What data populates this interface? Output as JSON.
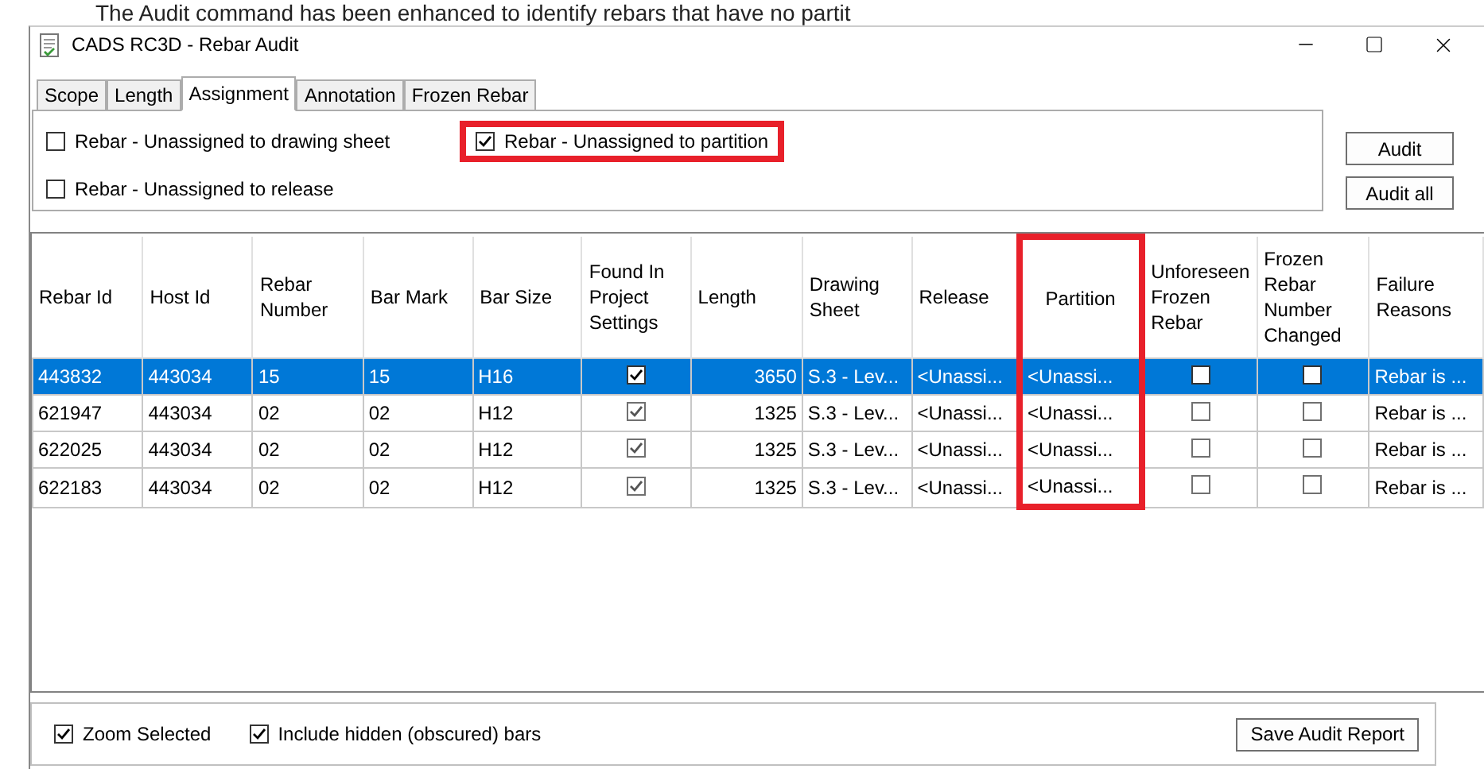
{
  "caption": "The Audit command has been enhanced to identify rebars that have no partit",
  "window": {
    "title": "CADS RC3D - Rebar Audit"
  },
  "tabs": [
    {
      "label": "Scope",
      "selected": false
    },
    {
      "label": "Length",
      "selected": false
    },
    {
      "label": "Assignment",
      "selected": true
    },
    {
      "label": "Annotation",
      "selected": false
    },
    {
      "label": "Frozen Rebar",
      "selected": false
    }
  ],
  "options": [
    {
      "label": "Rebar - Unassigned to drawing sheet",
      "checked": false,
      "highlighted": false
    },
    {
      "label": "Rebar - Unassigned to partition",
      "checked": true,
      "highlighted": true
    },
    {
      "label": "Rebar - Unassigned to release",
      "checked": false,
      "highlighted": false
    }
  ],
  "side_buttons": [
    "Audit",
    "Audit all"
  ],
  "table": {
    "columns": [
      {
        "label": "Rebar Id",
        "kind": "text",
        "highlighted": false
      },
      {
        "label": "Host Id",
        "kind": "text",
        "highlighted": false
      },
      {
        "label": "Rebar Number",
        "kind": "text",
        "highlighted": false
      },
      {
        "label": "Bar Mark",
        "kind": "text",
        "highlighted": false
      },
      {
        "label": "Bar Size",
        "kind": "text",
        "highlighted": false
      },
      {
        "label": "Found In Project Settings",
        "kind": "check",
        "highlighted": false
      },
      {
        "label": "Length",
        "kind": "number",
        "highlighted": false
      },
      {
        "label": "Drawing Sheet",
        "kind": "text",
        "highlighted": false
      },
      {
        "label": "Release",
        "kind": "text",
        "highlighted": false
      },
      {
        "label": "Partition",
        "kind": "text",
        "highlighted": true
      },
      {
        "label": "Unforeseen Frozen Rebar",
        "kind": "check",
        "highlighted": false
      },
      {
        "label": "Frozen Rebar Number Changed",
        "kind": "check",
        "highlighted": false
      },
      {
        "label": "Failure Reasons",
        "kind": "text",
        "highlighted": false
      }
    ],
    "rows": [
      {
        "selected": true,
        "cells": [
          "443832",
          "443034",
          "15",
          "15",
          "H16",
          true,
          "3650",
          "S.3 - Lev...",
          "<Unassi...",
          "<Unassi...",
          false,
          false,
          "Rebar is ..."
        ]
      },
      {
        "selected": false,
        "cells": [
          "621947",
          "443034",
          "02",
          "02",
          "H12",
          true,
          "1325",
          "S.3 - Lev...",
          "<Unassi...",
          "<Unassi...",
          false,
          false,
          "Rebar is ..."
        ]
      },
      {
        "selected": false,
        "cells": [
          "622025",
          "443034",
          "02",
          "02",
          "H12",
          true,
          "1325",
          "S.3 - Lev...",
          "<Unassi...",
          "<Unassi...",
          false,
          false,
          "Rebar is ..."
        ]
      },
      {
        "selected": false,
        "cells": [
          "622183",
          "443034",
          "02",
          "02",
          "H12",
          true,
          "1325",
          "S.3 - Lev...",
          "<Unassi...",
          "<Unassi...",
          false,
          false,
          "Rebar is ..."
        ]
      }
    ]
  },
  "footer": {
    "options": [
      {
        "label": "Zoom Selected",
        "checked": true
      },
      {
        "label": "Include hidden (obscured) bars",
        "checked": true
      }
    ],
    "button": "Save Audit Report"
  }
}
